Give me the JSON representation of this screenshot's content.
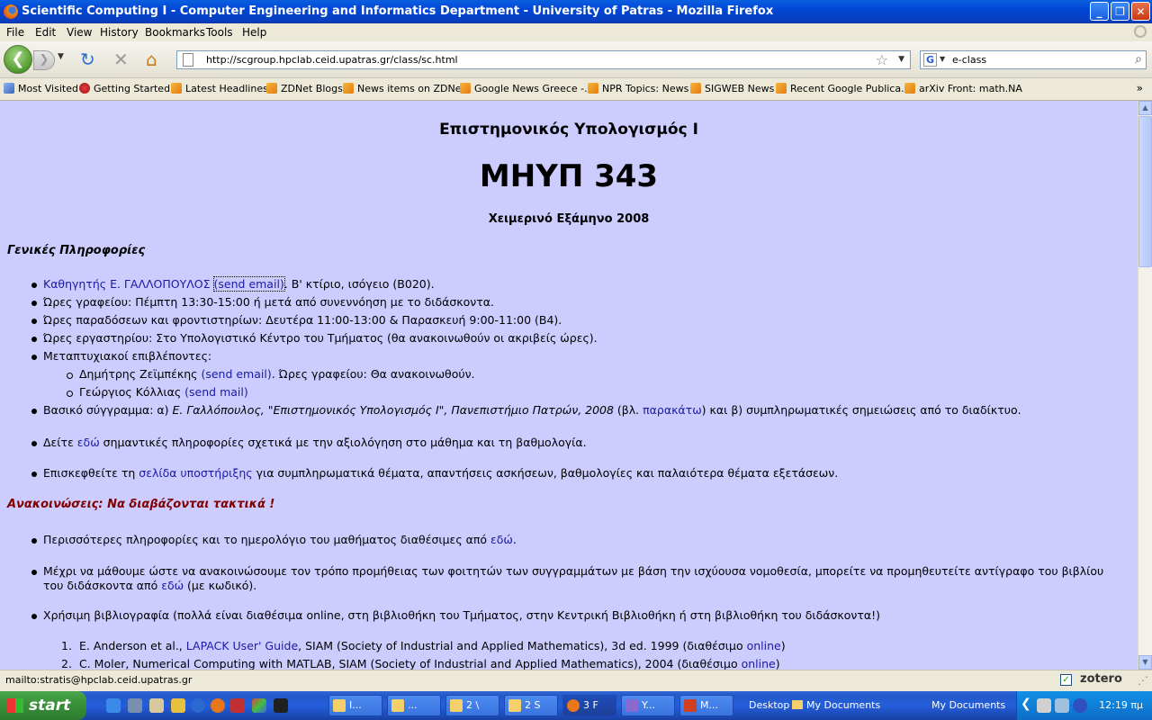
{
  "window": {
    "title": "Scientific Computing I - Computer Engineering and Informatics Department - University of Patras - Mozilla Firefox",
    "minimize": "_",
    "maximize": "❐",
    "close": "✕"
  },
  "menu": [
    "File",
    "Edit",
    "View",
    "History",
    "Bookmarks",
    "Tools",
    "Help"
  ],
  "nav": {
    "url": "http://scgroup.hpclab.ceid.upatras.gr/class/sc.html",
    "search_value": "e-class",
    "search_engine": "G"
  },
  "bookmarks": [
    "Most Visited",
    "Getting Started",
    "Latest Headlines",
    "ZDNet Blogs",
    "News items on ZDNet",
    "Google News Greece -...",
    "NPR Topics: News",
    "SIGWEB News",
    "Recent Google Publica...",
    "arXiv Front: math.NA"
  ],
  "bookmarks_more": "»",
  "page": {
    "subtitle": "Επιστημονικός Υπολογισμός Ι",
    "course_code": "ΜΗΥΠ 343",
    "semester": "Χειμερινό Εξάμηνο 2008",
    "general_heading": "Γενικές Πληροφορίες",
    "general": {
      "prof_link": "Καθηγητής Ε. ΓΑΛΛΟΠΟΥΛΟΣ",
      "prof_email": "(send email)",
      "prof_rest": ". Β' κτίριο, ισόγειο (Β020).",
      "office_hours": "Ώρες γραφείου: Πέμπτη 13:30-15:00 ή μετά από συνεννόηση με το διδάσκοντα.",
      "lecture_hours": "Ώρες παραδόσεων και φροντιστηρίων: Δευτέρα 11:00-13:00 & Παρασκευή 9:00-11:00 (Β4).",
      "lab_hours": "Ώρες εργαστηρίου: Στο Υπολογιστικό Κέντρο του Τμήματος (θα ανακοινωθούν οι ακριβείς ώρες).",
      "assistants_label": "Μεταπτυχιακοί επιβλέποντες:",
      "assistant1_name": "Δημήτρης Ζεϊμπέκης",
      "assistant1_email": "(send email)",
      "assistant1_rest": ". Ώρες γραφείου: Θα ανακοινωθούν.",
      "assistant2_name": "Γεώργιος Κόλλιας",
      "assistant2_email_pre": "(",
      "assistant2_email": "send mail",
      "assistant2_email_post": ")",
      "textbook_pre": "Βασικό σύγγραμμα: α) ",
      "textbook_italic": "Ε. Γαλλόπουλος, \"Επιστημονικός Υπολογισμός Ι\", Πανεπιστήμιο Πατρών, 2008",
      "textbook_mid": "  (βλ. ",
      "textbook_link": "παρακάτω",
      "textbook_post": ")  και β) συμπληρωματικές σημειώσεις από το διαδίκτυο.",
      "eval_pre": "Δείτε ",
      "eval_link": "εδώ",
      "eval_post": " σημαντικές πληροφορίες σχετικά με την αξιολόγηση στο μάθημα και τη βαθμολογία.",
      "support_pre": "Επισκεφθείτε τη ",
      "support_link": "σελίδα υποστήριξης",
      "support_post": " για συμπληρωματικά θέματα, απαντήσεις ασκήσεων, βαθμολογίες και παλαιότερα θέματα εξετάσεων."
    },
    "announcements_heading": "Ανακοινώσεις: Να διαβάζονται τακτικά !",
    "announcements": {
      "more_pre": "Περισσότερες πληροφορίες και το ημερολόγιο του μαθήματος διαθέσιμες από ",
      "more_link": "εδώ",
      "more_post": ".",
      "book_text": "Μέχρι να μάθουμε ώστε να ανακοινώσουμε τον τρόπο προμήθειας των φοιτητών των συγγραμμάτων με βάση την ισχύουσα νομοθεσία, μπορείτε να προμηθευτείτε αντίγραφο του βιβλίου του διδάσκοντα από ",
      "book_link": "εδώ",
      "book_post": " (με κωδικό).",
      "biblio": "Χρήσιμη βιβλιογραφία (πολλά είναι διαθέσιμα online, στη βιβλιοθήκη του Τμήματος, στην Κεντρική Βιβλιοθήκη ή στη βιβλιοθήκη του διδάσκοντα!)"
    },
    "references": [
      {
        "n": "1.",
        "pre": "E. Anderson et al., ",
        "link": "LAPACK User' Guide",
        "mid": ", SIAM (Society of Industrial and Applied Mathematics), 3d ed. 1999 (διαθέσιμο ",
        "link2": "online",
        "post": ")"
      },
      {
        "n": "2.",
        "pre": "C. Moler, Numerical Computing with MATLAB, SIAM (Society of Industrial and Applied Mathematics), 2004 (διαθέσιμο ",
        "link": "online",
        "post": ")"
      }
    ]
  },
  "status": {
    "text": "mailto:stratis@hpclab.ceid.upatras.gr",
    "zotero": "zotero"
  },
  "taskbar": {
    "start": "start",
    "items": [
      "I...",
      "...",
      "2 \\",
      "2 S",
      "3 F",
      "Y...",
      "M..."
    ],
    "desktop": "Desktop",
    "my_documents": "My Documents",
    "my_documents2": "My Documents",
    "clock": "12:19 πμ"
  }
}
